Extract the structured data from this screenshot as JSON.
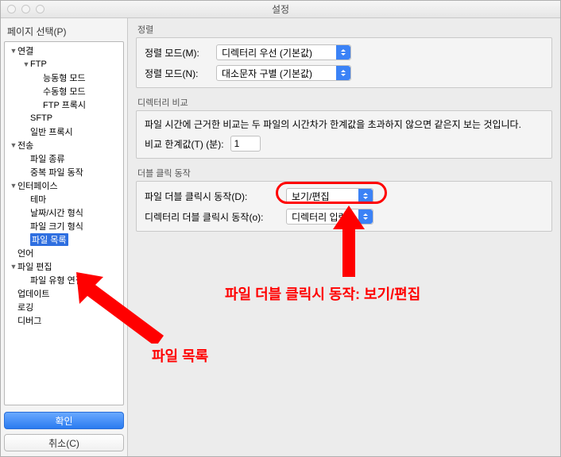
{
  "window": {
    "title": "설정"
  },
  "sidebar": {
    "page_select": "페이지 선택(P)",
    "items": [
      {
        "label": "연결",
        "depth": 0,
        "expanded": true
      },
      {
        "label": "FTP",
        "depth": 1,
        "expanded": true
      },
      {
        "label": "능동형 모드",
        "depth": 2
      },
      {
        "label": "수동형 모드",
        "depth": 2
      },
      {
        "label": "FTP 프록시",
        "depth": 2
      },
      {
        "label": "SFTP",
        "depth": 1
      },
      {
        "label": "일반 프록시",
        "depth": 1
      },
      {
        "label": "전송",
        "depth": 0,
        "expanded": true
      },
      {
        "label": "파일 종류",
        "depth": 1
      },
      {
        "label": "중복 파일 동작",
        "depth": 1
      },
      {
        "label": "인터페이스",
        "depth": 0,
        "expanded": true
      },
      {
        "label": "테마",
        "depth": 1
      },
      {
        "label": "날짜/시간 형식",
        "depth": 1
      },
      {
        "label": "파일 크기 형식",
        "depth": 1
      },
      {
        "label": "파일 목록",
        "depth": 1,
        "selected": true
      },
      {
        "label": "언어",
        "depth": 0
      },
      {
        "label": "파일 편집",
        "depth": 0,
        "expanded": true
      },
      {
        "label": "파일 유형 연결",
        "depth": 1
      },
      {
        "label": "업데이트",
        "depth": 0
      },
      {
        "label": "로깅",
        "depth": 0
      },
      {
        "label": "디버그",
        "depth": 0
      }
    ],
    "ok": "확인",
    "cancel": "취소(C)"
  },
  "main": {
    "sort_group_title": "정렬",
    "sort_mode_m_label": "정렬 모드(M):",
    "sort_mode_m_value": "디렉터리 우선 (기본값)",
    "sort_mode_n_label": "정렬 모드(N):",
    "sort_mode_n_value": "대소문자 구별 (기본값)",
    "compare_group_title": "디렉터리 비교",
    "compare_desc": "파일 시간에 근거한 비교는 두 파일의 시간차가 한계값을 초과하지 않으면 같은지 보는 것입니다.",
    "compare_threshold_label": "비교 한계값(T) (분):",
    "compare_threshold_value": "1",
    "dblclick_group_title": "더블 클릭 동작",
    "dblclick_file_label": "파일 더블 클릭시 동작(D):",
    "dblclick_file_value": "보기/편집",
    "dblclick_dir_label": "디렉터리 더블 클릭시 동작(o):",
    "dblclick_dir_value": "디렉터리 입력"
  },
  "annotations": {
    "text1": "파일 더블 클릭시 동작: 보기/편집",
    "text2": "파일 목록"
  }
}
